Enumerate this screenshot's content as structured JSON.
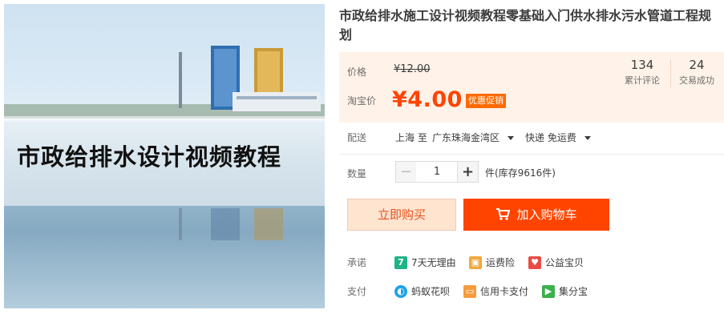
{
  "product": {
    "image_caption": "市政给排水设计视频教程",
    "title": "市政给排水施工设计视频教程零基础入门供水排水污水管道工程规划"
  },
  "price": {
    "label": "价格",
    "original": "¥12.00",
    "promo_label": "淘宝价",
    "promo": "¥4.00",
    "badge": "优惠促销"
  },
  "stats": [
    {
      "value": "134",
      "label": "累计评论"
    },
    {
      "value": "24",
      "label": "交易成功"
    }
  ],
  "delivery": {
    "label": "配送",
    "from": "上海 至",
    "to": "广东珠海金湾区",
    "method": "快递 免运费"
  },
  "quantity": {
    "label": "数量",
    "minus": "−",
    "value": "1",
    "plus": "+",
    "stock": "件(库存9616件)"
  },
  "actions": {
    "buy_now": "立即购买",
    "add_cart": "加入购物车"
  },
  "promise": {
    "label": "承诺",
    "items": [
      {
        "icon": "seven-day-icon",
        "glyph": "7",
        "color": "#1fb487",
        "text": "7天无理由"
      },
      {
        "icon": "shipping-insurance-icon",
        "glyph": "",
        "color": "#f3a73b",
        "text": "运费险"
      },
      {
        "icon": "charity-icon",
        "glyph": "",
        "color": "#e94c46",
        "text": "公益宝贝"
      }
    ]
  },
  "payment": {
    "label": "支付",
    "items": [
      {
        "icon": "huabei-icon",
        "color": "#1ea3e6",
        "text": "蚂蚁花呗"
      },
      {
        "icon": "credit-card-icon",
        "color": "#f59c3d",
        "text": "信用卡支付"
      },
      {
        "icon": "jifenbao-icon",
        "color": "#3bb04c",
        "text": "集分宝"
      }
    ]
  },
  "colors": {
    "accent": "#ff4400",
    "price_panel": "#fff2e8"
  }
}
